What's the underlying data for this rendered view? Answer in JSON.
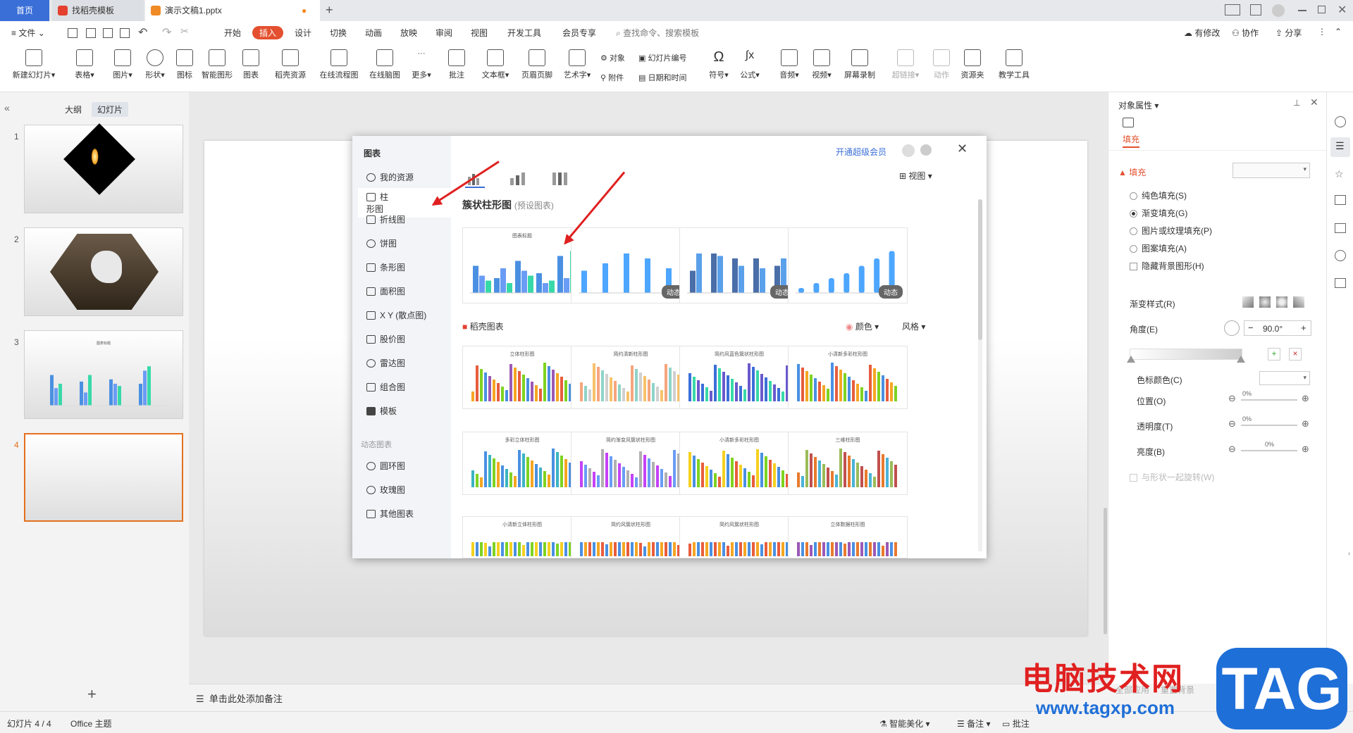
{
  "tabs": {
    "home": "首页",
    "template": "找稻壳模板",
    "doc": "演示文稿1.pptx"
  },
  "menu": {
    "file": "文件",
    "items": [
      "开始",
      "插入",
      "设计",
      "切换",
      "动画",
      "放映",
      "审阅",
      "视图",
      "开发工具",
      "会员专享"
    ],
    "active": "插入",
    "search": "查找命令、搜索模板",
    "modify": "有修改",
    "collab": "协作",
    "share": "分享"
  },
  "ribbon": {
    "buttons": [
      "新建幻灯片",
      "表格",
      "图片",
      "形状",
      "图标",
      "智能图形",
      "图表",
      "稻壳资源",
      "在线流程图",
      "在线脑图",
      "更多",
      "批注",
      "文本框",
      "页眉页脚",
      "艺术字",
      "符号",
      "公式",
      "音频",
      "视频",
      "屏幕录制",
      "超链接",
      "动作",
      "资源夹",
      "教学工具"
    ],
    "small": {
      "object": "对象",
      "slide_num": "幻灯片编号",
      "attach": "附件",
      "datetime": "日期和时间"
    }
  },
  "left": {
    "outline": "大纲",
    "slides": "幻灯片",
    "slide_nums": [
      "1",
      "2",
      "3",
      "4"
    ],
    "thumb3_title": "图表标题"
  },
  "dialog": {
    "title": "图表",
    "vip": "开通超级会员",
    "categories": [
      "我的资源",
      "柱形图",
      "折线图",
      "饼图",
      "条形图",
      "面积图",
      "X Y (散点图)",
      "股价图",
      "雷达图",
      "组合图",
      "模板"
    ],
    "dynamic_title": "动态图表",
    "dynamic": [
      "圆环图",
      "玫瑰图",
      "其他图表"
    ],
    "view": "视图",
    "section1": "簇状柱形图",
    "section1_sub": "(预设图表)",
    "preset_title": "图表标题",
    "dyn_badge": "动态",
    "section2": "稻壳图表",
    "color": "颜色",
    "style": "风格",
    "template_titles": [
      "立体柱形图",
      "简约清新柱形图",
      "简约风蓝色簇状柱形图",
      "小清新多彩柱形图",
      "多彩立体柱形图",
      "简约渐变风簇状柱形图",
      "小清新多彩柱形图",
      "三维柱形图",
      "小清新立体柱形图",
      "简约风簇状柱形图",
      "简约风簇状柱形图",
      "立体数据柱形图"
    ]
  },
  "right": {
    "header": "对象属性",
    "fill_tab": "填充",
    "fill_section": "填充",
    "options": [
      "纯色填充(S)",
      "渐变填充(G)",
      "图片或纹理填充(P)",
      "图案填充(A)"
    ],
    "hide_bg": "隐藏背景图形(H)",
    "grad_style": "渐变样式(R)",
    "angle": "角度(E)",
    "angle_val": "90.0°",
    "stop_color": "色标颜色(C)",
    "position": "位置(O)",
    "transparency": "透明度(T)",
    "brightness": "亮度(B)",
    "pos_val": "0%",
    "trans_val": "0%",
    "bright_val": "0%",
    "rotate": "与形状一起旋转(W)",
    "apply_all": "全部应用",
    "reset_bg": "重置背景"
  },
  "notes": "单击此处添加备注",
  "status": {
    "slide": "幻灯片 4 / 4",
    "theme": "Office 主题",
    "beautify": "智能美化",
    "notes": "备注",
    "comment": "批注"
  },
  "watermark": {
    "cn": "电脑技术网",
    "url": "www.tagxp.com",
    "tag": "TAG"
  },
  "colors": {
    "accent": "#e4502f",
    "blue": "#3b6fd8",
    "arrow": "#e02020"
  }
}
